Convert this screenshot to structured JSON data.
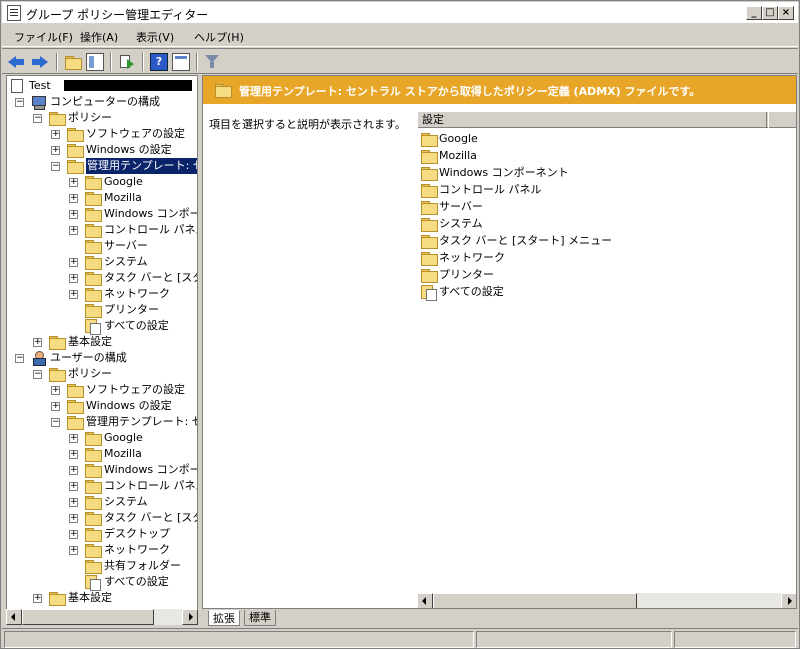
{
  "window": {
    "title": "グループ ポリシー管理エディター"
  },
  "menu": [
    "ファイル(F)",
    "操作(A)",
    "表示(V)",
    "ヘルプ(H)"
  ],
  "tree": [
    {
      "label": "Test",
      "indent": 0,
      "icon": "doc-icon",
      "expander": null,
      "redacted": true
    },
    {
      "label": "コンピューターの構成",
      "indent": 1,
      "icon": "computer-icon",
      "expander": "-"
    },
    {
      "label": "ポリシー",
      "indent": 2,
      "icon": "folder-icon",
      "expander": "-"
    },
    {
      "label": "ソフトウェアの設定",
      "indent": 3,
      "icon": "folder-icon",
      "expander": "+"
    },
    {
      "label": "Windows の設定",
      "indent": 3,
      "icon": "folder-icon",
      "expander": "+"
    },
    {
      "label": "管理用テンプレート: セントラル",
      "indent": 3,
      "icon": "folder-icon",
      "expander": "-",
      "selected": true
    },
    {
      "label": "Google",
      "indent": 4,
      "icon": "folder-icon",
      "expander": "+"
    },
    {
      "label": "Mozilla",
      "indent": 4,
      "icon": "folder-icon",
      "expander": "+"
    },
    {
      "label": "Windows コンポーネント",
      "indent": 4,
      "icon": "folder-icon",
      "expander": "+"
    },
    {
      "label": "コントロール パネル",
      "indent": 4,
      "icon": "folder-icon",
      "expander": "+"
    },
    {
      "label": "サーバー",
      "indent": 4,
      "icon": "folder-icon",
      "expander": null
    },
    {
      "label": "システム",
      "indent": 4,
      "icon": "folder-icon",
      "expander": "+"
    },
    {
      "label": "タスク バーと [スタート] メニュー",
      "indent": 4,
      "icon": "folder-icon",
      "expander": "+"
    },
    {
      "label": "ネットワーク",
      "indent": 4,
      "icon": "folder-icon",
      "expander": "+"
    },
    {
      "label": "プリンター",
      "indent": 4,
      "icon": "folder-icon",
      "expander": null
    },
    {
      "label": "すべての設定",
      "indent": 4,
      "icon": "settings-icon",
      "expander": null
    },
    {
      "label": "基本設定",
      "indent": 2,
      "icon": "folder-icon",
      "expander": "+"
    },
    {
      "label": "ユーザーの構成",
      "indent": 1,
      "icon": "user-icon",
      "expander": "-"
    },
    {
      "label": "ポリシー",
      "indent": 2,
      "icon": "folder-icon",
      "expander": "-"
    },
    {
      "label": "ソフトウェアの設定",
      "indent": 3,
      "icon": "folder-icon",
      "expander": "+"
    },
    {
      "label": "Windows の設定",
      "indent": 3,
      "icon": "folder-icon",
      "expander": "+"
    },
    {
      "label": "管理用テンプレート: セントラル",
      "indent": 3,
      "icon": "folder-icon",
      "expander": "-"
    },
    {
      "label": "Google",
      "indent": 4,
      "icon": "folder-icon",
      "expander": "+"
    },
    {
      "label": "Mozilla",
      "indent": 4,
      "icon": "folder-icon",
      "expander": "+"
    },
    {
      "label": "Windows コンポーネント",
      "indent": 4,
      "icon": "folder-icon",
      "expander": "+"
    },
    {
      "label": "コントロール パネル",
      "indent": 4,
      "icon": "folder-icon",
      "expander": "+"
    },
    {
      "label": "システム",
      "indent": 4,
      "icon": "folder-icon",
      "expander": "+"
    },
    {
      "label": "タスク バーと [スタート] メニュー",
      "indent": 4,
      "icon": "folder-icon",
      "expander": "+"
    },
    {
      "label": "デスクトップ",
      "indent": 4,
      "icon": "folder-icon",
      "expander": "+"
    },
    {
      "label": "ネットワーク",
      "indent": 4,
      "icon": "folder-icon",
      "expander": "+"
    },
    {
      "label": "共有フォルダー",
      "indent": 4,
      "icon": "folder-icon",
      "expander": null
    },
    {
      "label": "すべての設定",
      "indent": 4,
      "icon": "settings-icon",
      "expander": null
    },
    {
      "label": "基本設定",
      "indent": 2,
      "icon": "folder-icon",
      "expander": "+"
    }
  ],
  "details": {
    "banner": "管理用テンプレート: セントラル ストアから取得したポリシー定義 (ADMX) ファイルです。",
    "description": "項目を選択すると説明が表示されます。",
    "column_header": "設定",
    "items": [
      {
        "label": "Google",
        "icon": "folder-icon"
      },
      {
        "label": "Mozilla",
        "icon": "folder-icon"
      },
      {
        "label": "Windows コンポーネント",
        "icon": "folder-icon"
      },
      {
        "label": "コントロール パネル",
        "icon": "folder-icon"
      },
      {
        "label": "サーバー",
        "icon": "folder-icon"
      },
      {
        "label": "システム",
        "icon": "folder-icon"
      },
      {
        "label": "タスク バーと [スタート] メニュー",
        "icon": "folder-icon"
      },
      {
        "label": "ネットワーク",
        "icon": "folder-icon"
      },
      {
        "label": "プリンター",
        "icon": "folder-icon"
      },
      {
        "label": "すべての設定",
        "icon": "settings-icon"
      }
    ]
  },
  "tabs": [
    "拡張",
    "標準"
  ],
  "colors": {
    "banner": "#e8a628",
    "selection": "#0a246a"
  }
}
